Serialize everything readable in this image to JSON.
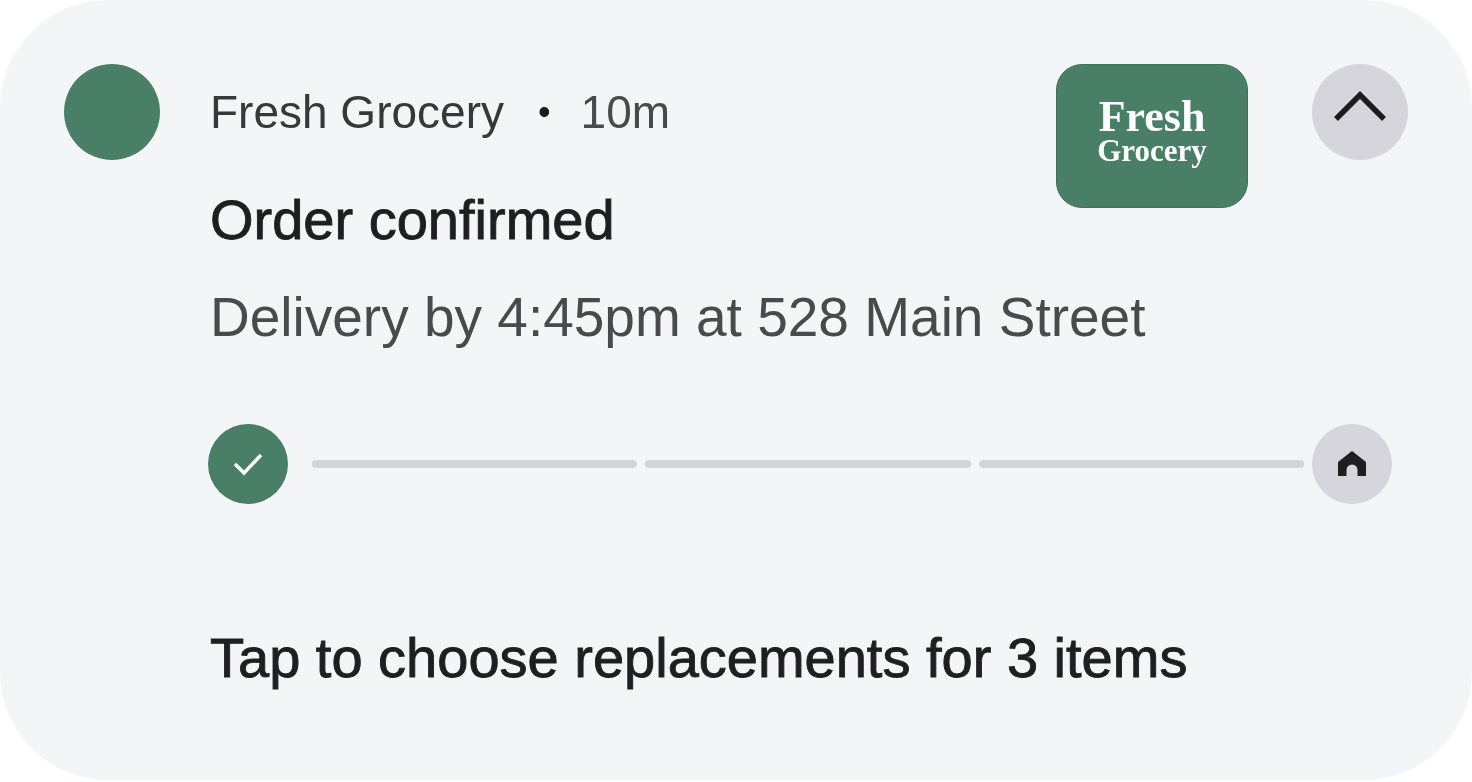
{
  "notification": {
    "app_name": "Fresh Grocery",
    "separator": "•",
    "time": "10m",
    "title": "Order confirmed",
    "text": "Delivery by 4:45pm at 528 Main Street",
    "logo": {
      "line_1": "Fresh",
      "line_2": "Grocery"
    },
    "expanded": true,
    "progress": {
      "start_done": true,
      "segments": [
        {
          "done": false
        },
        {
          "done": false
        },
        {
          "done": false
        }
      ],
      "end_reached": false
    },
    "action_text": "Tap to choose replacements for 3 items"
  }
}
